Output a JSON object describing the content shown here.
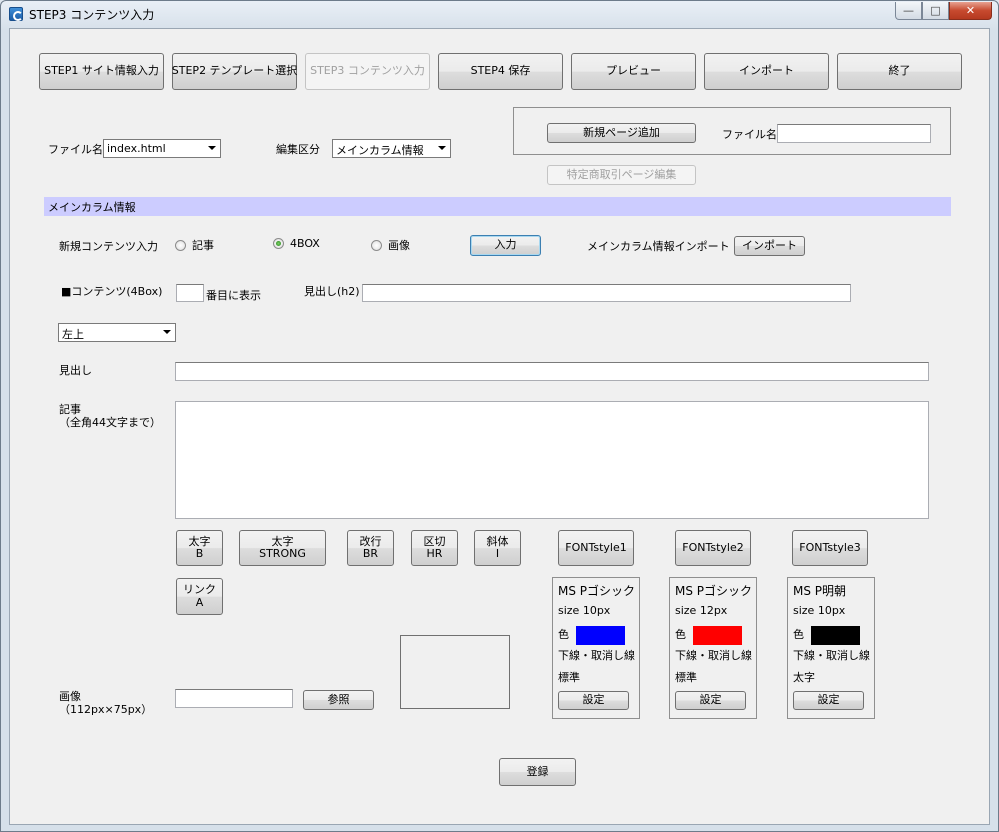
{
  "window": {
    "title": "STEP3 コンテンツ入力",
    "minimize_glyph": "—",
    "maximize_glyph": "□",
    "close_glyph": "✕"
  },
  "steps": [
    {
      "label": "STEP1 サイト情報入力"
    },
    {
      "label": "STEP2 テンプレート選択"
    },
    {
      "label": "STEP3 コンテンツ入力"
    },
    {
      "label": "STEP4 保存"
    },
    {
      "label": "プレビュー"
    },
    {
      "label": "インポート"
    },
    {
      "label": "終了"
    }
  ],
  "newpage": {
    "add_button": "新規ページ追加",
    "filename_label": "ファイル名",
    "filename_value": "",
    "tokutei_button": "特定商取引ページ編集"
  },
  "file": {
    "label": "ファイル名",
    "selected": "index.html"
  },
  "section_type": {
    "label": "編集区分",
    "selected": "メインカラム情報"
  },
  "section_bar": "メインカラム情報",
  "new_content": {
    "label": "新規コンテンツ入力",
    "options": [
      "記事",
      "4BOX",
      "画像"
    ],
    "selected": "4BOX",
    "input_button": "入力",
    "import_label": "メインカラム情報インポート",
    "import_button": "インポート"
  },
  "content4box": {
    "label": "■コンテンツ(4Box)",
    "order_value": "",
    "order_suffix": "番目に表示",
    "h2_label": "見出し(h2)",
    "h2_value": ""
  },
  "position_select": "左上",
  "heading": {
    "label": "見出し",
    "value": ""
  },
  "article": {
    "label_line1": "記事",
    "label_line2": "（全角44文字まで）",
    "value": ""
  },
  "format_buttons": [
    {
      "line1": "太字",
      "line2": "B"
    },
    {
      "line1": "太字",
      "line2": "STRONG"
    },
    {
      "line1": "改行",
      "line2": "BR"
    },
    {
      "line1": "区切",
      "line2": "HR"
    },
    {
      "line1": "斜体",
      "line2": "I"
    },
    {
      "line1": "リンク",
      "line2": "A"
    }
  ],
  "fontstyles": [
    {
      "button": "FONTstyle1",
      "font": "MS Pゴシック",
      "size": "size 10px",
      "color_label": "色",
      "color": "#0000ff",
      "decoration": "下線・取消し線",
      "weight": "標準",
      "set_button": "設定"
    },
    {
      "button": "FONTstyle2",
      "font": "MS Pゴシック",
      "size": "size 12px",
      "color_label": "色",
      "color": "#ff0000",
      "decoration": "下線・取消し線",
      "weight": "標準",
      "set_button": "設定"
    },
    {
      "button": "FONTstyle3",
      "font": "MS P明朝",
      "size": "size 10px",
      "color_label": "色",
      "color": "#000000",
      "decoration": "下線・取消し線",
      "weight": "太字",
      "set_button": "設定"
    }
  ],
  "image": {
    "label_line1": "画像",
    "label_line2": "（112px×75px）",
    "path_value": "",
    "browse_button": "参照"
  },
  "register_button": "登録"
}
